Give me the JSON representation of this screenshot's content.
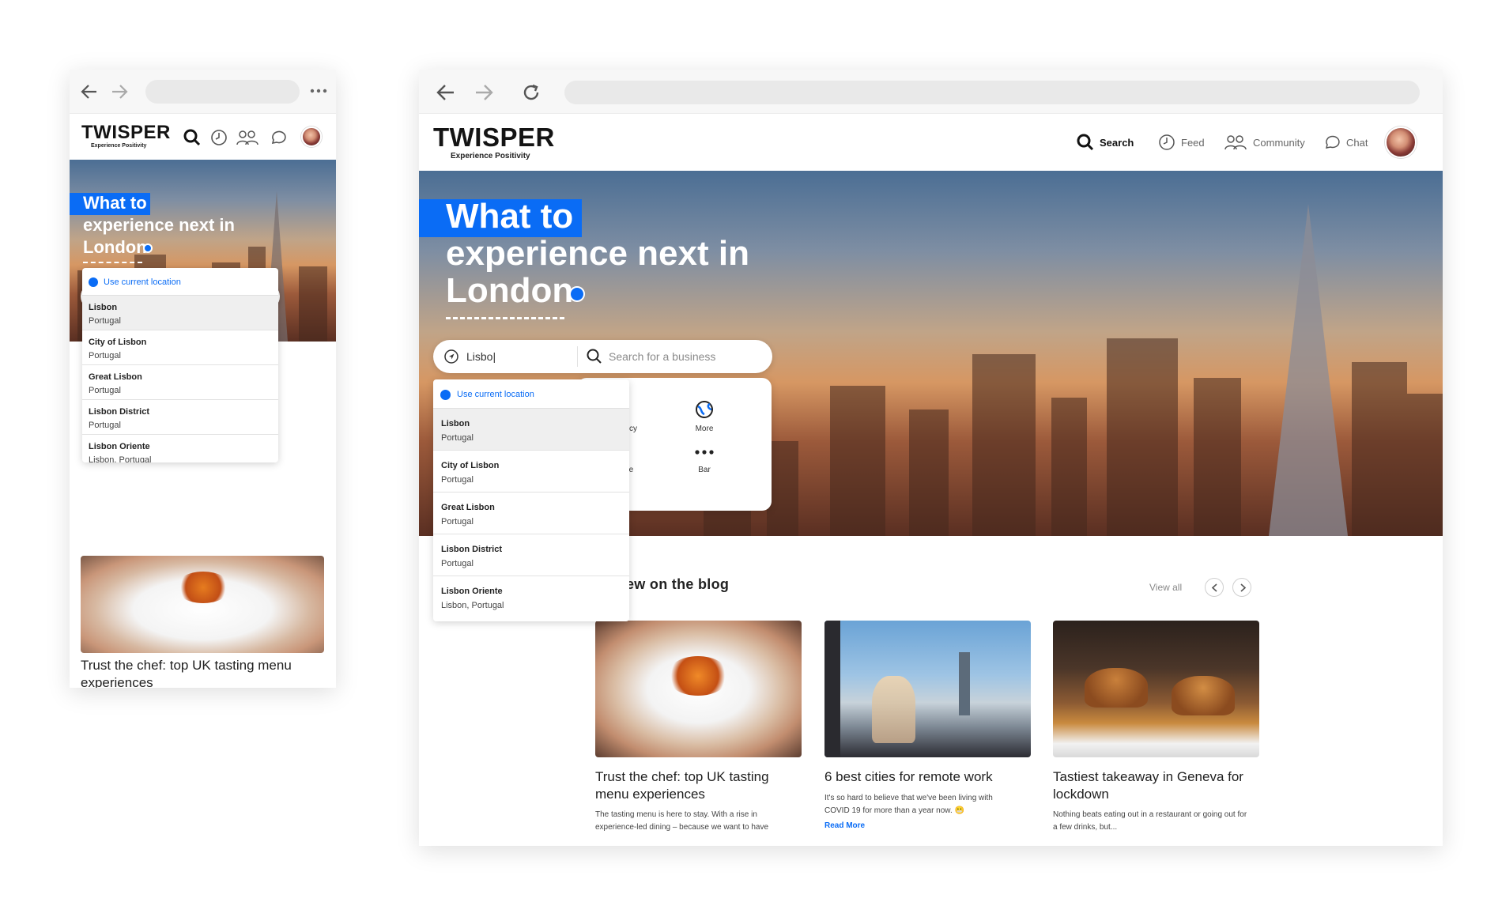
{
  "brand": {
    "name": "TWISPER",
    "tagline": "Experience Positivity",
    "accent": "#0a6cf5"
  },
  "nav": {
    "search": "Search",
    "feed": "Feed",
    "community": "Community",
    "chat": "Chat"
  },
  "hero": {
    "line1": "What to",
    "line2": "experience next in",
    "city": "London"
  },
  "search": {
    "location_value": "Lisbo|",
    "business_placeholder": "Search for a business"
  },
  "dropdown": {
    "current_location": "Use current location",
    "items": [
      {
        "title": "Lisbon",
        "subtitle": "Portugal"
      },
      {
        "title": "City of Lisbon",
        "subtitle": "Portugal"
      },
      {
        "title": "Great Lisbon",
        "subtitle": "Portugal"
      },
      {
        "title": "Lisbon District",
        "subtitle": "Portugal"
      },
      {
        "title": "Lisbon Oriente",
        "subtitle": "Lisbon, Portugal"
      }
    ]
  },
  "categories": [
    {
      "label": "avel Agency",
      "icon": "cocktail-icon"
    },
    {
      "label": "More",
      "icon": "globe-icon"
    },
    {
      "label": "eal Estate",
      "icon": "house-icon"
    },
    {
      "label": "Bar",
      "icon": "dots-icon"
    }
  ],
  "blog": {
    "heading": "ew on the blog",
    "view_all": "View all",
    "cards": [
      {
        "title": "Trust the chef: top UK tasting menu experiences",
        "excerpt": "The tasting menu is here to stay. With a rise in experience-led dining – because we want to have",
        "read_more": ""
      },
      {
        "title": "6 best cities for remote work",
        "excerpt": "It's so hard to believe that we've been living with COVID 19 for more than a year now. 😬",
        "read_more": "Read More"
      },
      {
        "title": "Tastiest takeaway in Geneva for lockdown",
        "excerpt": "Nothing beats eating out in a restaurant or going out for a few drinks, but...",
        "read_more": ""
      }
    ]
  },
  "mobile": {
    "card_title": "Trust the chef: top UK tasting menu experiences"
  }
}
